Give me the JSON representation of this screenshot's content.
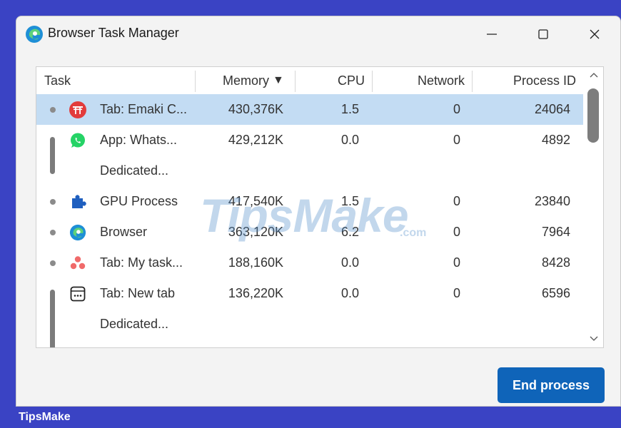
{
  "window": {
    "title": "Browser Task Manager"
  },
  "columns": {
    "task": "Task",
    "memory": "Memory",
    "memory_sort": "▼",
    "cpu": "CPU",
    "network": "Network",
    "pid": "Process ID"
  },
  "rows": [
    {
      "task": "Tab: Emaki C...",
      "memory": "430,376K",
      "cpu": "1.5",
      "network": "0",
      "pid": "24064",
      "icon": "torii-gate-icon",
      "selected": true
    },
    {
      "task": "App: Whats...",
      "memory": "429,212K",
      "cpu": "0.0",
      "network": "0",
      "pid": "4892",
      "icon": "whatsapp-icon"
    },
    {
      "task": "Dedicated...",
      "memory": "",
      "cpu": "",
      "network": "",
      "pid": "",
      "icon": ""
    },
    {
      "task": "GPU Process",
      "memory": "417,540K",
      "cpu": "1.5",
      "network": "0",
      "pid": "23840",
      "icon": "puzzle-icon"
    },
    {
      "task": "Browser",
      "memory": "363,120K",
      "cpu": "6.2",
      "network": "0",
      "pid": "7964",
      "icon": "edge-icon"
    },
    {
      "task": "Tab: My task...",
      "memory": "188,160K",
      "cpu": "0.0",
      "network": "0",
      "pid": "8428",
      "icon": "asana-icon"
    },
    {
      "task": "Tab: New tab",
      "memory": "136,220K",
      "cpu": "0.0",
      "network": "0",
      "pid": "6596",
      "icon": "new-tab-icon"
    },
    {
      "task": "Dedicated...",
      "memory": "",
      "cpu": "",
      "network": "",
      "pid": "",
      "icon": ""
    }
  ],
  "actions": {
    "end_process": "End process"
  },
  "watermark": {
    "text": "TipsMake",
    "suffix": ".com"
  },
  "footer": {
    "brand": "TipsMake"
  },
  "colors": {
    "accent": "#0f64b9",
    "selection": "#c3dcf3",
    "frame": "#3a43c4"
  }
}
